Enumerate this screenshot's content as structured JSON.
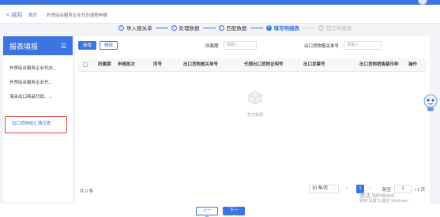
{
  "header": {
    "back_label": "返回",
    "breadcrumb": {
      "home": "首页",
      "separator": "-",
      "current": "外贸综合服务企业代办退税申报"
    }
  },
  "steps": [
    {
      "label": "导入报关单",
      "mark": "✓",
      "state": "done"
    },
    {
      "label": "处理数据",
      "mark": "✓",
      "state": "done"
    },
    {
      "label": "匹配数据",
      "mark": "✓",
      "state": "done"
    },
    {
      "label": "填写明细表",
      "mark": "4",
      "state": "active"
    },
    {
      "label": "提交申报表",
      "mark": "5",
      "state": "pending"
    }
  ],
  "sidebar": {
    "title": "报表填报",
    "menu_icon": "menu-icon",
    "items": [
      {
        "label": "外贸综合服务企业代办...",
        "type": "group"
      },
      {
        "label": "外贸综合服务企业代...",
        "type": "item"
      },
      {
        "label": "海关出口商品代码、...",
        "type": "item"
      },
      {
        "label": "出口货物收汇情况表",
        "type": "item",
        "selected": true
      }
    ]
  },
  "toolbar": {
    "add_label": "新增",
    "delete_label": "删除"
  },
  "filters": [
    {
      "label": "所属期",
      "placeholder": "请输入"
    },
    {
      "label": "出口货物报关单号",
      "placeholder": "请输入"
    }
  ],
  "table": {
    "columns": [
      "所属期",
      "申报批次",
      "序号",
      "出口货物报关单号",
      "代理出口货物证明号",
      "出口发票号",
      "出口货物销售额币种",
      "操作"
    ],
    "rows": [],
    "empty_text": "暂无数据",
    "empty_icon": "empty-box-icon"
  },
  "pagination": {
    "total": "共 0 条",
    "page_size": "10 条/页",
    "prev": "‹",
    "current_page": "1",
    "next": "›",
    "jump_label": "跳至",
    "jump_value": "1",
    "page_count": "/ 1 页"
  },
  "footer": {
    "prev_step_label": "上一步",
    "next_step_label": "下一步"
  },
  "watermark": {
    "line1": "激活 Windows",
    "line2": "转到\"设置\"以激活 Windows。"
  },
  "colors": {
    "accent": "#3c74e0",
    "highlight_border": "#e0443d"
  }
}
